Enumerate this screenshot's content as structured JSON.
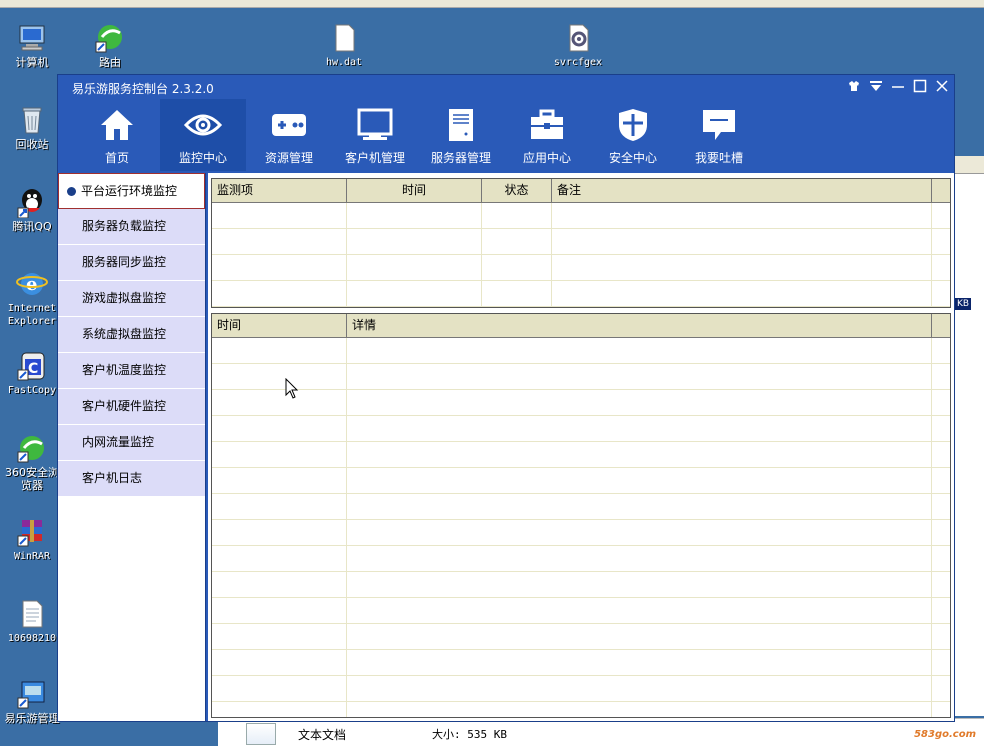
{
  "desktop": {
    "icons": [
      {
        "label": "计算机"
      },
      {
        "label": "回收站"
      },
      {
        "label": "腾讯QQ"
      },
      {
        "label": "Internet Explorer"
      },
      {
        "label": "FastCopy"
      },
      {
        "label": "360安全浏览器"
      },
      {
        "label": "WinRAR"
      },
      {
        "label": "10698210"
      },
      {
        "label": "易乐游管理"
      },
      {
        "label": "路由"
      },
      {
        "label": "hw.dat"
      },
      {
        "label": "svrcfgex"
      }
    ],
    "file_row": {
      "name": "文本文档",
      "size": "大小: 535 KB"
    },
    "bg_window_badge": "KB",
    "watermark": "583go.com"
  },
  "app": {
    "title": "易乐游服务控制台 2.3.2.0",
    "nav": [
      {
        "label": "首页"
      },
      {
        "label": "监控中心"
      },
      {
        "label": "资源管理"
      },
      {
        "label": "客户机管理"
      },
      {
        "label": "服务器管理"
      },
      {
        "label": "应用中心"
      },
      {
        "label": "安全中心"
      },
      {
        "label": "我要吐槽"
      }
    ],
    "side_menu": [
      {
        "label": "平台运行环境监控"
      },
      {
        "label": "服务器负载监控"
      },
      {
        "label": "服务器同步监控"
      },
      {
        "label": "游戏虚拟盘监控"
      },
      {
        "label": "系统虚拟盘监控"
      },
      {
        "label": "客户机温度监控"
      },
      {
        "label": "客户机硬件监控"
      },
      {
        "label": "内网流量监控"
      },
      {
        "label": "客户机日志"
      }
    ],
    "monitor_table": {
      "columns": [
        "监测项",
        "时间",
        "状态",
        "备注"
      ],
      "rows": []
    },
    "log_table": {
      "columns": [
        "时间",
        "详情"
      ],
      "rows": []
    }
  },
  "colors": {
    "window_blue": "#2a5ab8",
    "nav_active": "#1e4ea8",
    "side_item": "#dcdcf8",
    "table_header": "#e4e2c4"
  }
}
